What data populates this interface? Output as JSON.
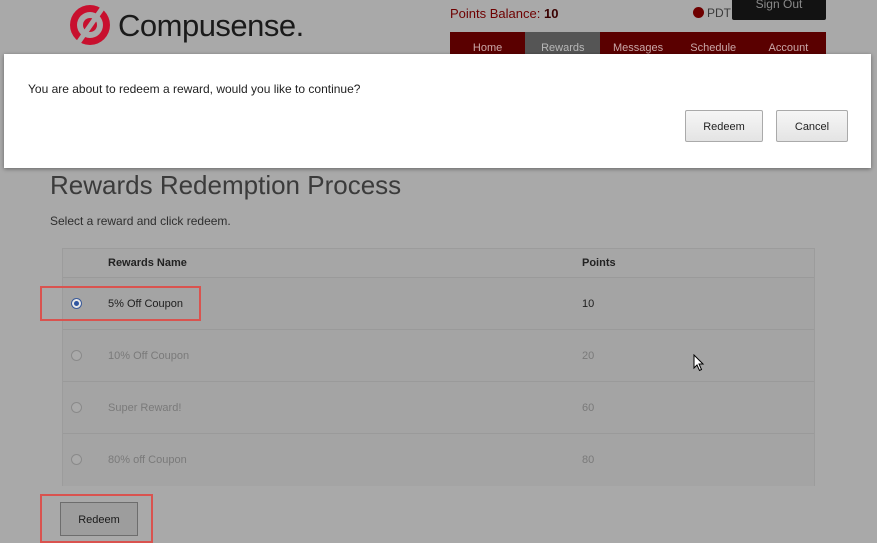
{
  "header": {
    "brand": "Compusense.",
    "points_label": "Points Balance:",
    "points_value": "10",
    "timezone": "PDT",
    "signout_label": "Sign Out",
    "nav": [
      "Home",
      "Rewards",
      "Messages",
      "Schedule",
      "Account"
    ],
    "active_nav": "Rewards"
  },
  "modal": {
    "message": "You are about to redeem a reward, would you like to continue?",
    "redeem_label": "Redeem",
    "cancel_label": "Cancel"
  },
  "page": {
    "title": "Rewards Redemption Process",
    "subtitle": "Select a reward and click redeem.",
    "columns": [
      "Rewards Name",
      "Points"
    ],
    "rows": [
      {
        "name": "5% Off Coupon",
        "points": "10",
        "selected": true
      },
      {
        "name": "10% Off Coupon",
        "points": "20",
        "selected": false
      },
      {
        "name": "Super Reward!",
        "points": "60",
        "selected": false
      },
      {
        "name": "80% off Coupon",
        "points": "80",
        "selected": false
      }
    ],
    "redeem_label": "Redeem"
  },
  "colors": {
    "brand_red": "#c8102e",
    "nav_red": "#5a0000",
    "highlight": "#d9534f"
  }
}
